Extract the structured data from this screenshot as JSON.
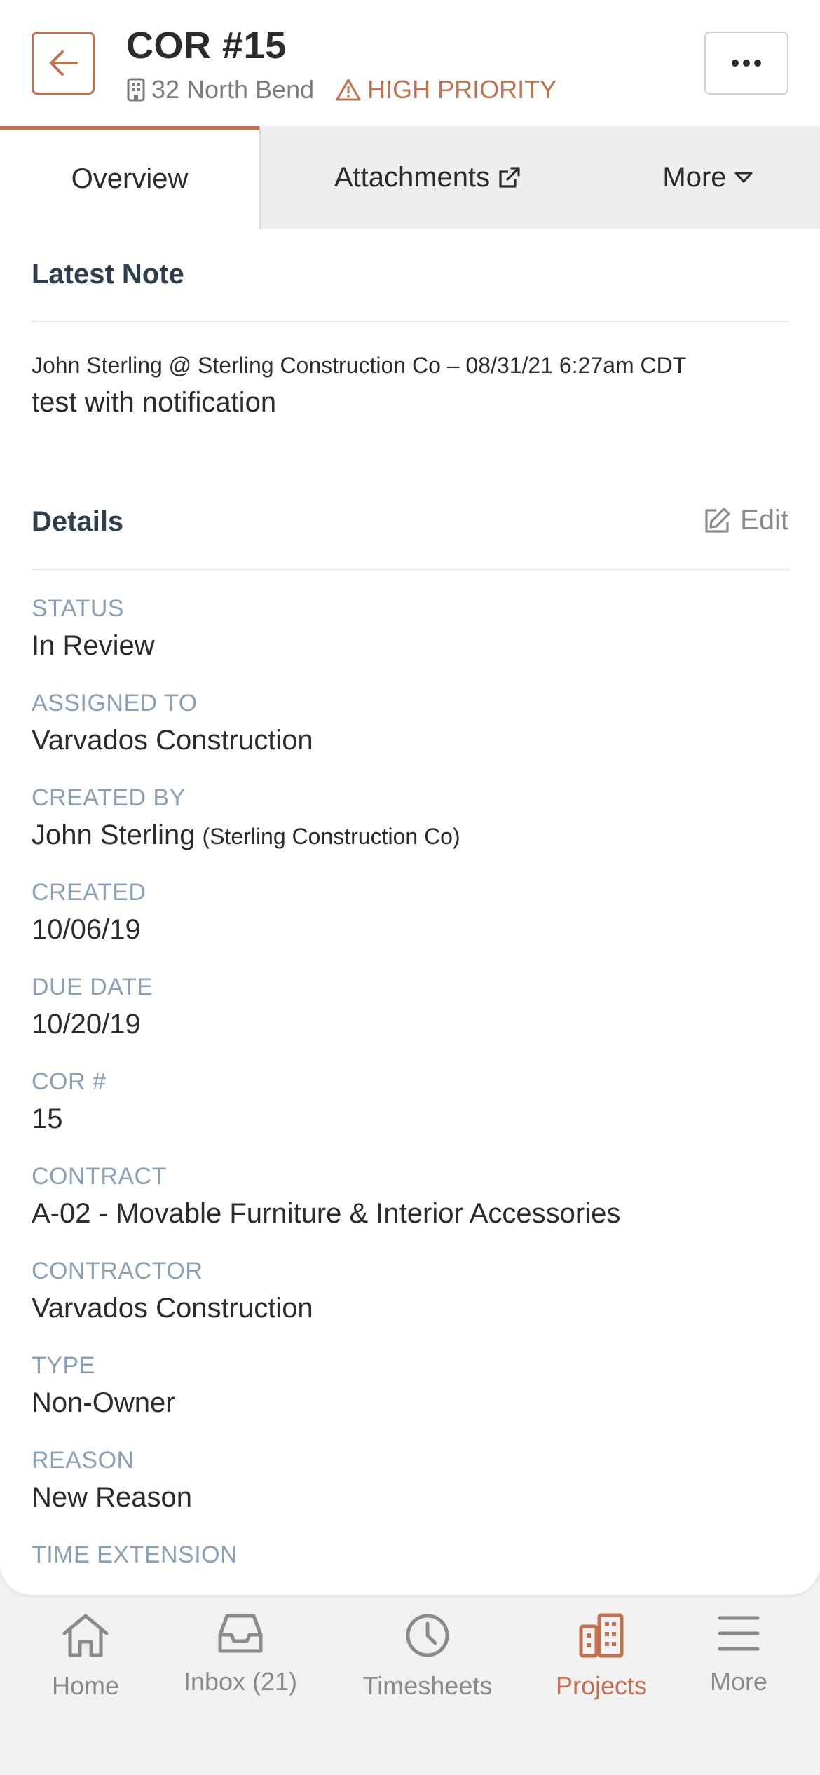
{
  "header": {
    "title": "COR #15",
    "location": "32 North Bend",
    "priority": "HIGH PRIORITY",
    "back_icon": "arrow-left-icon",
    "menu_icon": "ellipsis-icon"
  },
  "tabs": [
    {
      "label": "Overview",
      "active": true
    },
    {
      "label": "Attachments",
      "icon": "external-link-icon"
    },
    {
      "label": "More",
      "icon": "caret-down-icon"
    }
  ],
  "latest_note": {
    "title": "Latest Note",
    "meta": "John Sterling @ Sterling Construction Co – 08/31/21 6:27am CDT",
    "body": "test with notification"
  },
  "details": {
    "title": "Details",
    "edit_label": "Edit",
    "fields": [
      {
        "label": "STATUS",
        "value": "In Review"
      },
      {
        "label": "ASSIGNED TO",
        "value": "Varvados Construction"
      },
      {
        "label": "CREATED BY",
        "value": "John Sterling",
        "sub": "(Sterling Construction Co)"
      },
      {
        "label": "CREATED",
        "value": "10/06/19"
      },
      {
        "label": "DUE DATE",
        "value": "10/20/19"
      },
      {
        "label": "COR #",
        "value": "15"
      },
      {
        "label": "CONTRACT",
        "value": "A-02 - Movable Furniture & Interior Accessories"
      },
      {
        "label": "CONTRACTOR",
        "value": "Varvados Construction"
      },
      {
        "label": "TYPE",
        "value": "Non-Owner"
      },
      {
        "label": "REASON",
        "value": "New Reason"
      },
      {
        "label": "TIME EXTENSION",
        "value": ""
      }
    ]
  },
  "bottom_nav": [
    {
      "label": "Home",
      "icon": "home-icon"
    },
    {
      "label": "Inbox (21)",
      "icon": "inbox-icon"
    },
    {
      "label": "Timesheets",
      "icon": "clock-icon"
    },
    {
      "label": "Projects",
      "icon": "buildings-icon",
      "active": true
    },
    {
      "label": "More",
      "icon": "menu-icon"
    }
  ],
  "colors": {
    "accent": "#c0714f",
    "label": "#8aa0b6",
    "section_title": "#2f3e4e"
  }
}
